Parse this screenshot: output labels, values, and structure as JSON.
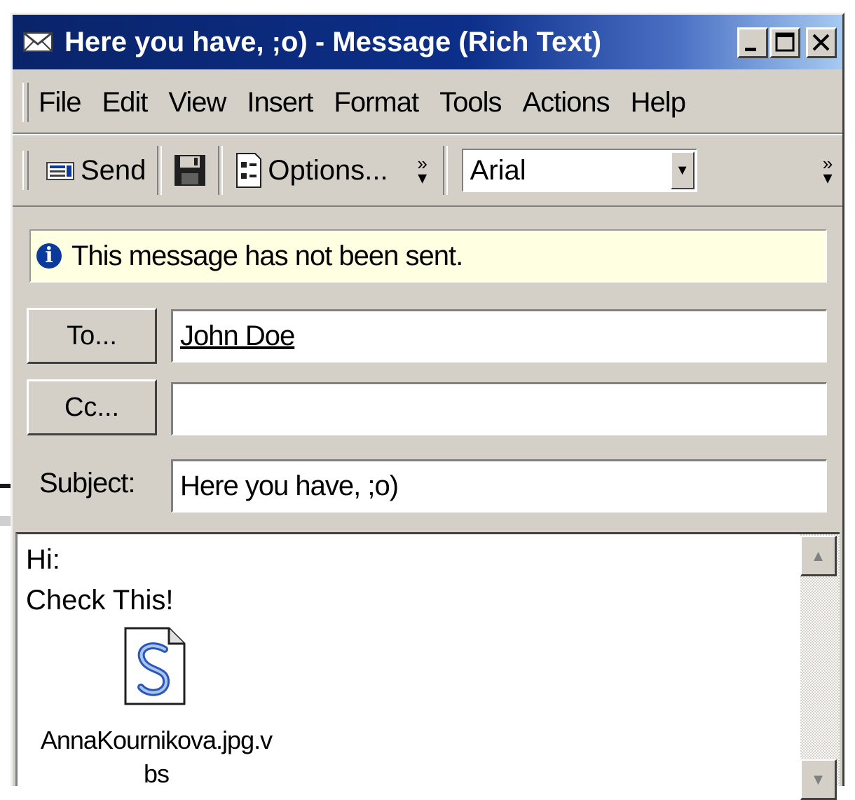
{
  "window": {
    "title": "Here you have, ;o) - Message (Rich Text)"
  },
  "menubar": {
    "items": [
      "File",
      "Edit",
      "View",
      "Insert",
      "Format",
      "Tools",
      "Actions",
      "Help"
    ]
  },
  "toolbar": {
    "send_label": "Send",
    "options_label": "Options...",
    "more_label": "»",
    "font_value": "Arial"
  },
  "infobar": {
    "text": "This message has not been sent."
  },
  "header": {
    "to_button": "To...",
    "to_value": "John Doe",
    "cc_button": "Cc...",
    "cc_value": "",
    "subject_label": "Subject:",
    "subject_value": "Here you have, ;o)"
  },
  "body": {
    "line1": "Hi:",
    "line2": "Check This!",
    "attachment_name_1": "AnnaKournikova.jpg.v",
    "attachment_name_2": "bs"
  },
  "colors": {
    "titlebar": "#0a246a",
    "chrome": "#d4d0c8",
    "infobar": "#ffffe1"
  },
  "icons": {
    "title": "envelope-icon",
    "send": "send-icon",
    "save": "floppy-disk-icon",
    "options": "options-icon",
    "info": "info-icon",
    "attachment": "vbscript-file-icon"
  }
}
